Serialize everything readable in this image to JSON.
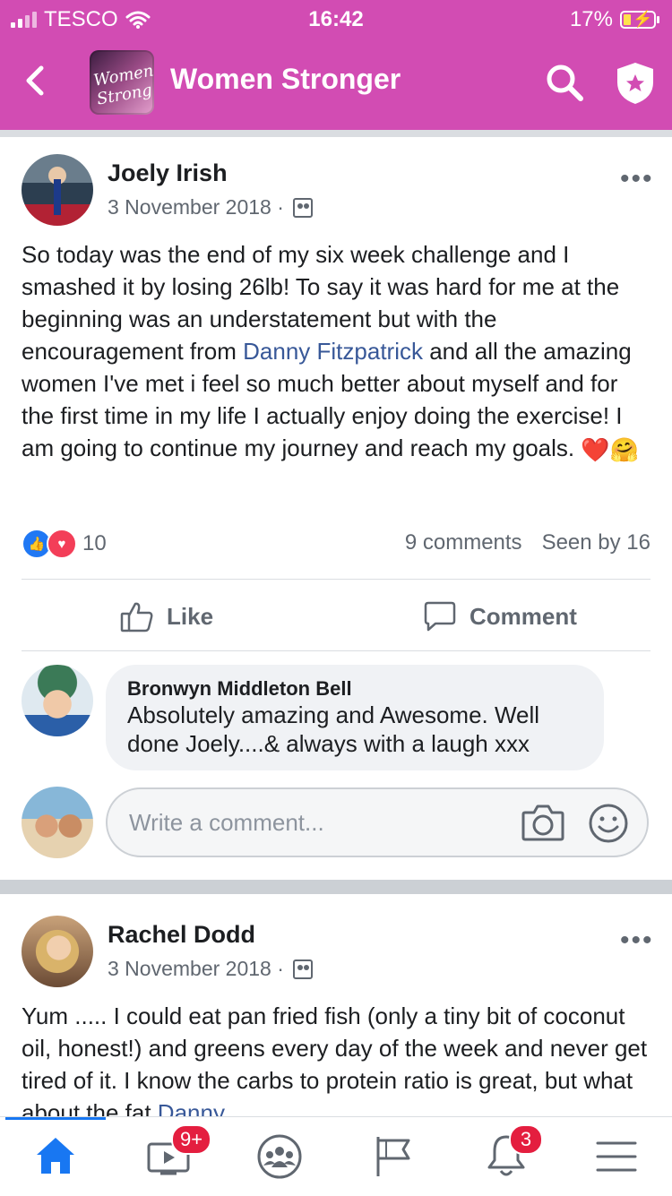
{
  "status_bar": {
    "carrier": "TESCO",
    "time": "16:42",
    "battery": "17%"
  },
  "header": {
    "title": "Women Stronger",
    "avatar_text": "Women Strong"
  },
  "colors": {
    "brand_pink": "#d24cb3",
    "link_blue": "#385898",
    "active_blue": "#1877f2",
    "badge_red": "#e41e3f"
  },
  "post1": {
    "author": "Joely Irish",
    "date": "3 November 2018 ·",
    "text_1": "So today was the end of my six week challenge and I smashed it by losing 26lb! To say it was hard for me at the beginning was an understatement but with the encouragement from ",
    "mention": "Danny Fitzpatrick",
    "text_2": " and all the amazing women I've met i feel so much better about myself and for the first time in my life I actually enjoy doing the exercise! I am going to continue my journey and reach my goals. ",
    "reaction_count": "10",
    "comments_count": "9 comments",
    "seen_by": "Seen by 16",
    "like_label": "Like",
    "comment_label": "Comment"
  },
  "comment": {
    "author": "Bronwyn Middleton Bell",
    "text": "Absolutely amazing and Awesome. Well done Joely....& always with a laugh xxx"
  },
  "composer": {
    "placeholder": "Write a comment..."
  },
  "post2": {
    "author": "Rachel Dodd",
    "date": "3 November 2018 ·",
    "text_1": "Yum ..... I could eat pan fried fish (only a tiny bit of coconut oil, honest!) and greens every day of the week and never get tired of it.   I know the carbs to protein ratio is great, but what about the fat ",
    "mention": "Danny"
  },
  "tab_bar": {
    "items": [
      "home-icon",
      "video-icon",
      "groups-icon",
      "pages-icon",
      "notifications-icon",
      "menu-icon"
    ],
    "video_badge": "9+",
    "notifications_badge": "3"
  }
}
